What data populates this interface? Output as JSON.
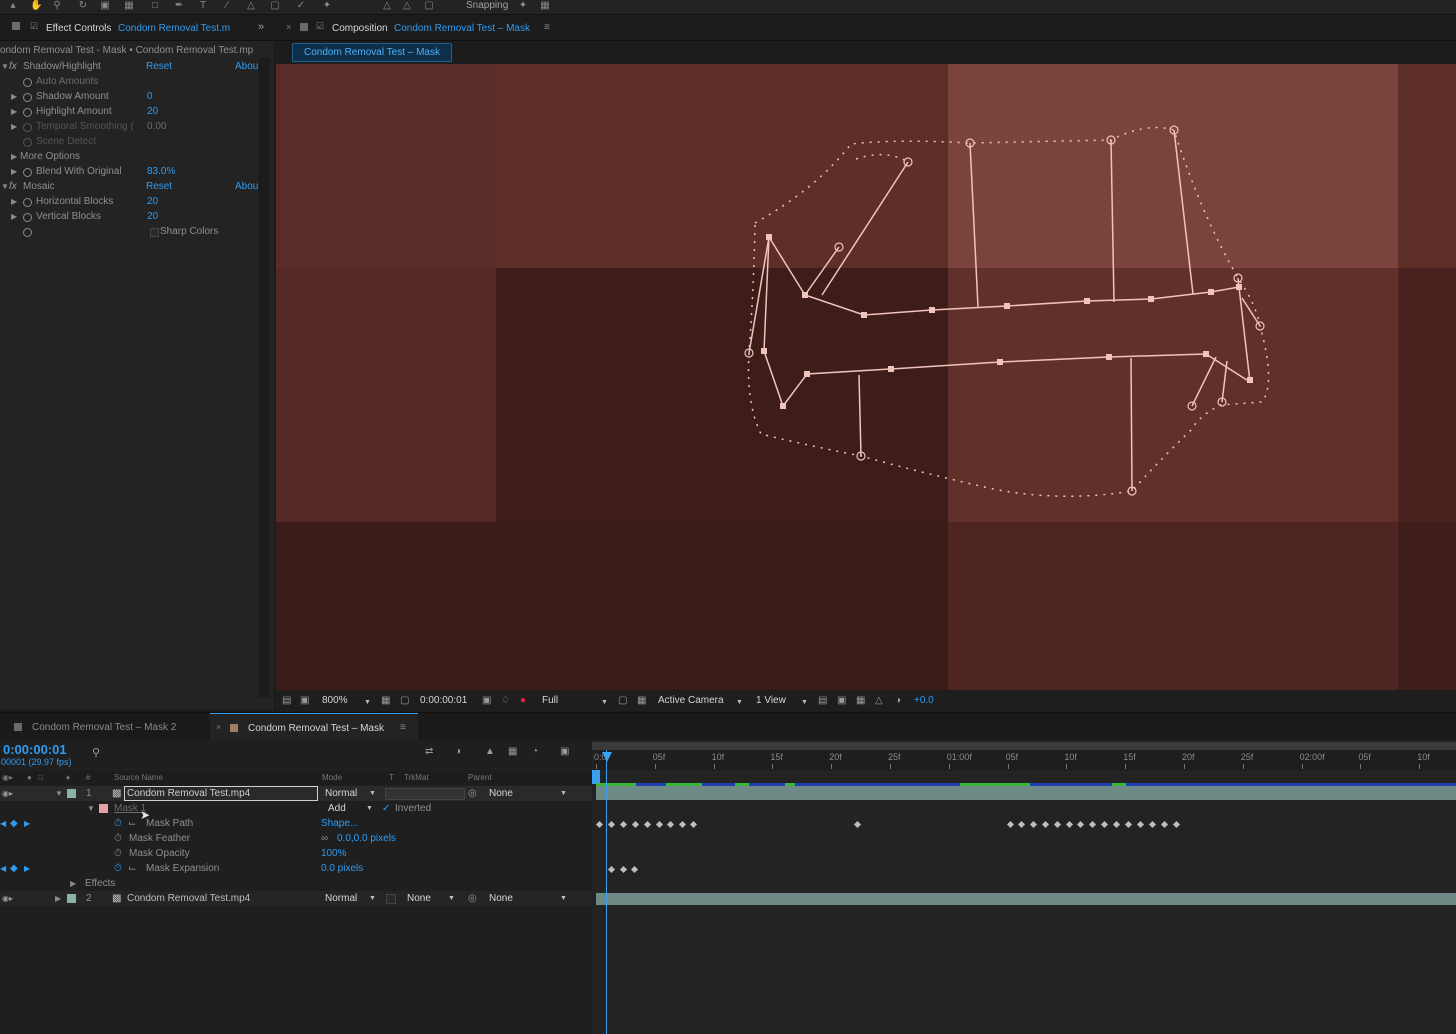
{
  "toolbar": {
    "snapping_label": "Snapping"
  },
  "effect_controls": {
    "tab_label": "Effect Controls",
    "tab_file": "Condom Removal Test.m",
    "path": "ondom Removal Test - Mask • Condom Removal Test.mp",
    "effects": [
      {
        "name": "Shadow/Highlight",
        "reset": "Reset",
        "about": "Abou",
        "props": [
          {
            "label": "Auto Amounts",
            "value": ""
          },
          {
            "label": "Shadow Amount",
            "value": "0"
          },
          {
            "label": "Highlight Amount",
            "value": "20"
          },
          {
            "label": "Temporal Smoothing (",
            "value": "0.00"
          },
          {
            "label": "Scene Detect",
            "value": ""
          },
          {
            "label": "More Options",
            "value": ""
          },
          {
            "label": "Blend With Original",
            "value": "83.0%"
          }
        ]
      },
      {
        "name": "Mosaic",
        "reset": "Reset",
        "about": "Abou",
        "props": [
          {
            "label": "Horizontal Blocks",
            "value": "20"
          },
          {
            "label": "Vertical Blocks",
            "value": "20"
          },
          {
            "label": "",
            "value": "Sharp Colors"
          }
        ]
      }
    ]
  },
  "composition": {
    "tab_label": "Composition",
    "tab_name": "Condom Removal Test – Mask",
    "sub_tab": "Condom Removal Test – Mask",
    "viewer_bar": {
      "zoom": "800%",
      "timecode": "0:00:00:01",
      "resolution": "Full",
      "camera": "Active Camera",
      "views": "1 View",
      "exposure": "+0.0"
    },
    "colors": {
      "mask_path": "#f0c4bc",
      "accent": "#2f9bf0"
    }
  },
  "timeline": {
    "tabs": [
      "Condom Removal Test – Mask 2",
      "Condom Removal Test – Mask"
    ],
    "active_tab": 1,
    "timecode": "0:00:00:01",
    "fps": "00001 (29.97 fps)",
    "headers": {
      "source": "Source Name",
      "mode": "Mode",
      "t": "T",
      "trkmat": "TrkMat",
      "parent": "Parent"
    },
    "ruler": [
      "0:0",
      "05f",
      "10f",
      "15f",
      "20f",
      "25f",
      "01:00f",
      "05f",
      "10f",
      "15f",
      "20f",
      "25f",
      "02:00f",
      "05f",
      "10f"
    ],
    "layers": [
      {
        "num": "1",
        "name": "Condom Removal Test.mp4",
        "mode": "Normal",
        "trkmat": "",
        "parent": "None"
      },
      {
        "num": "2",
        "name": "Condom Removal Test.mp4",
        "mode": "Normal",
        "trkmat": "None",
        "parent": "None"
      }
    ],
    "mask": {
      "name": "Mask 1",
      "mode": "Add",
      "inverted": "Inverted",
      "props": [
        {
          "label": "Mask Path",
          "value": "Shape..."
        },
        {
          "label": "Mask Feather",
          "value": "0.0,0.0 pixels"
        },
        {
          "label": "Mask Opacity",
          "value": "100%"
        },
        {
          "label": "Mask Expansion",
          "value": "0.0 pixels"
        }
      ]
    },
    "effects_label": "Effects",
    "colors": {
      "layer_bar": "#6e8a86",
      "playhead": "#3aa0f0",
      "keyframe": "#bdbdbd"
    }
  }
}
